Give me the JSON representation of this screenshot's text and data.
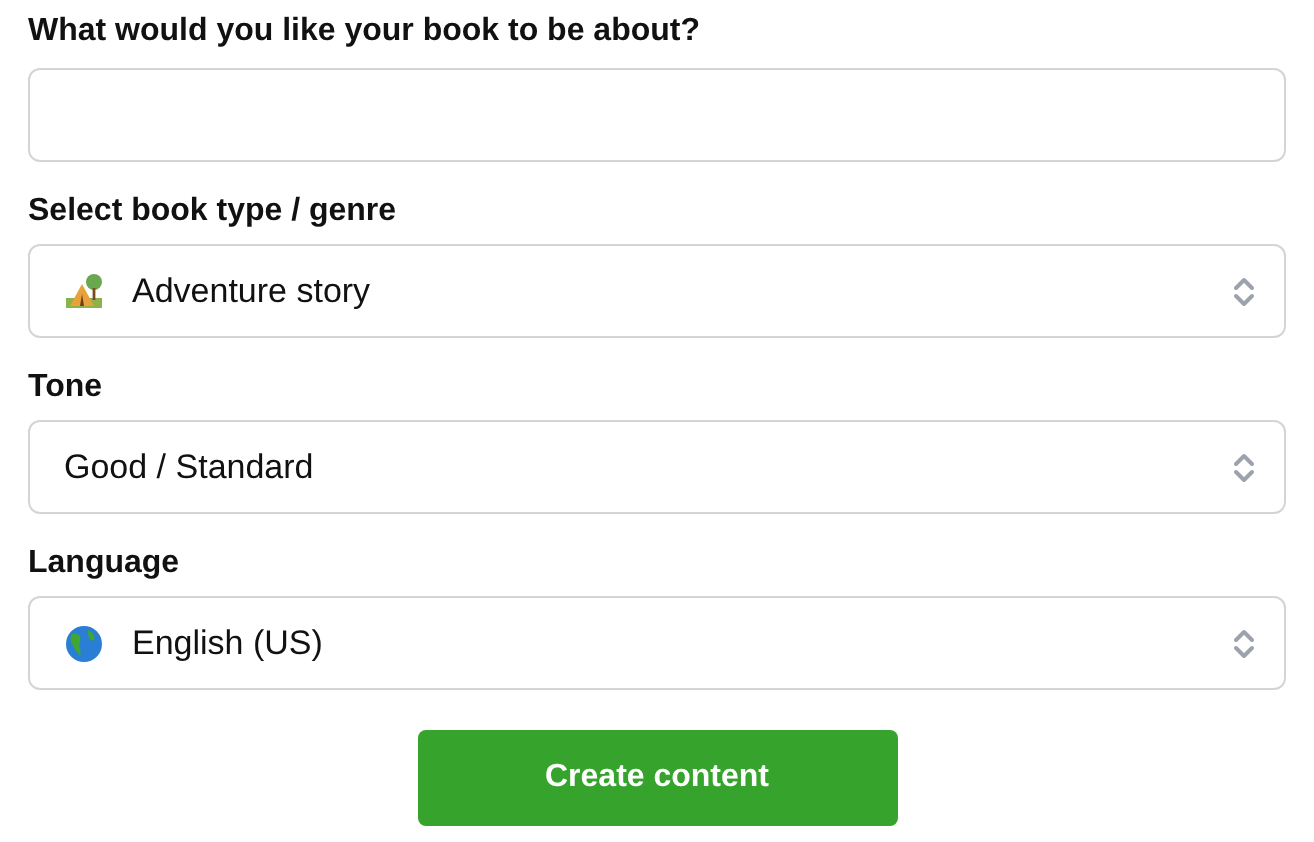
{
  "topic": {
    "label": "What would you like your book to be about?"
  },
  "selects": [
    {
      "label": "Select book type / genre",
      "value": "Adventure story",
      "kind": "tent"
    },
    {
      "label": "Tone",
      "value": "Good / Standard",
      "kind": "plain"
    },
    {
      "label": "Language",
      "value": "English (US)",
      "kind": "globe"
    }
  ],
  "submit": "Create content"
}
